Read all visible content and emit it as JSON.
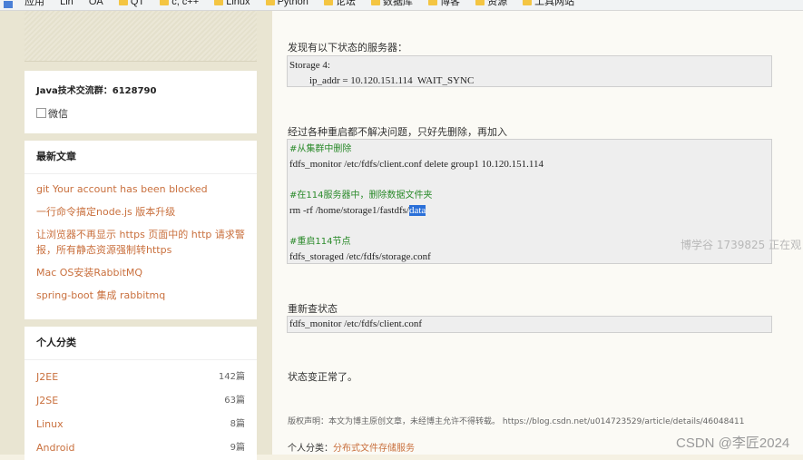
{
  "bookmarks_bar": {
    "items": [
      "应用",
      "Lin",
      "OA",
      "QT",
      "c, c++",
      "Linux",
      "Python",
      "论坛",
      "数据库",
      "博客",
      "资源",
      "工具网站"
    ]
  },
  "sidebar": {
    "qq_group": "Java技术交流群：6128790",
    "wechat_alt": "微信",
    "recent_title": "最新文章",
    "recent_articles": [
      "git Your account has been blocked",
      "一行命令搞定node.js 版本升级",
      "让浏览器不再显示 https 页面中的 http 请求警报，所有静态资源强制转https",
      "Mac OS安装RabbitMQ",
      "spring-boot 集成 rabbitmq"
    ],
    "category_title": "个人分类",
    "categories": [
      {
        "name": "J2EE",
        "count": "142篇"
      },
      {
        "name": "J2SE",
        "count": "63篇"
      },
      {
        "name": "Linux",
        "count": "8篇"
      },
      {
        "name": "Android",
        "count": "9篇"
      }
    ]
  },
  "main": {
    "found_text": "发现有以下状态的服务器：",
    "status_code": [
      "Storage 4:",
      "ip_addr = 10.120.151.114  WAIT_SYNC"
    ],
    "restart_text": "经过各种重启都不解决问题，只好先删除，再加入",
    "fix_code": {
      "c1": "#从集群中删除",
      "l1": "fdfs_monitor /etc/fdfs/client.conf delete group1 10.120.151.114",
      "c2": "#在114服务器中，删除数据文件夹",
      "l2_pre": "rm -rf /home/storage1/fastdfs/",
      "l2_hl": "data",
      "c3": "#重启114节点",
      "l3": "fdfs_storaged /etc/fdfs/storage.conf"
    },
    "recheck_text": "重新查状态",
    "recheck_code": "fdfs_monitor /etc/fdfs/client.conf",
    "normal_text": "状态变正常了。",
    "copyright": "版权声明：本文为博主原创文章，未经博主允许不得转载。 https://blog.csdn.net/u014723529/article/details/46048411",
    "category_label": "个人分类：",
    "category_link": "分布式文件存储服务"
  },
  "overlay": {
    "watching": "博学谷 1739825 正在观",
    "csdn": "CSDN @李匠2024"
  },
  "colors": {
    "link": "#c9703e",
    "comment": "#2a8a2a",
    "selection": "#2a6fd8"
  }
}
